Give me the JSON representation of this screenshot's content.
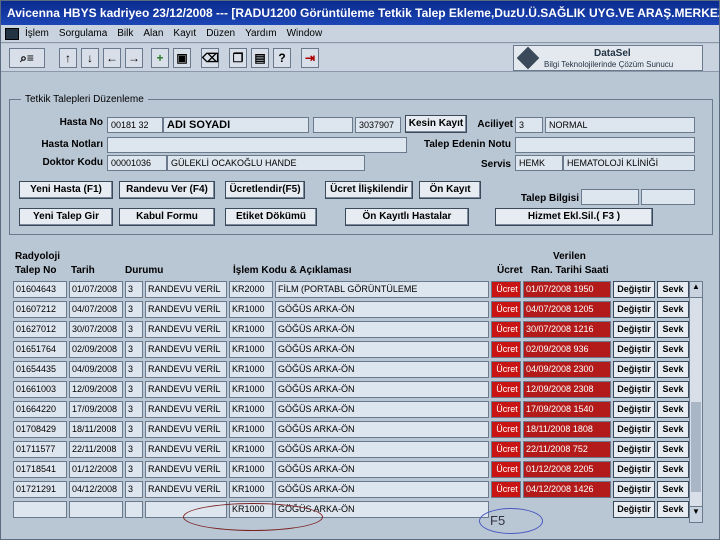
{
  "window": {
    "title": "Avicenna HBYS kadriyeo 23/12/2008 --- [RADU1200 Görüntüleme Tetkik Talep Ekleme,DuzU.Ü.SAĞLIK UYG.VE ARAŞ.MERKEZİ]"
  },
  "menu": [
    "İşlem",
    "Sorgulama",
    "Bilk",
    "Alan",
    "Kayıt",
    "Düzen",
    "Yardım",
    "Window"
  ],
  "toolbar": {
    "icons": [
      "query-icon",
      "arrow-up-icon",
      "arrow-down-icon",
      "arrow-left-icon",
      "arrow-right-icon",
      "insert-icon",
      "save-icon",
      "delete-icon",
      "copy-icon",
      "paste-icon",
      "help-icon",
      "exit-icon"
    ]
  },
  "logo": {
    "name": "DataSel",
    "tagline": "Bilgi Teknolojilerinde Çözüm Sunucu"
  },
  "form": {
    "section_title": "Tetkik Talepleri Düzenleme",
    "hasta_no_label": "Hasta No",
    "hasta_no": "00181 32",
    "hasta_adi": "ADI SOYADI",
    "protokol": "3037907",
    "kesin_kayit": "Kesin Kayıt",
    "aciliyet_label": "Aciliyet",
    "aciliyet_kod": "3",
    "aciliyet": "NORMAL",
    "hasta_notlari_label": "Hasta Notları",
    "talep_eden_notu_label": "Talep Edenin Notu",
    "doktor_kodu_label": "Doktor Kodu",
    "doktor_kodu": "00001036",
    "doktor_adi": "GÜLEKLİ OCAKOĞLU HANDE",
    "servis_label": "Servis",
    "servis_kod": "HEMK",
    "servis": "HEMATOLOJİ KLİNİĞİ",
    "talep_bilgisi_label": "Talep Bilgisi"
  },
  "buttons": {
    "yeni_hasta": "Yeni Hasta (F1)",
    "randevu_ver": "Randevu Ver (F4)",
    "ucretlendir": "Ücretlendir(F5)",
    "ucret_iliskilendir": "Ücret İlişkilendir",
    "on_kayit": "Ön Kayıt",
    "yeni_talep_gir": "Yeni Talep Gir",
    "kabul_formu": "Kabul Formu",
    "etiket_dokumu": "Etiket Dökümü",
    "on_kayitli_hastalar": "Ön Kayıtlı Hastalar",
    "hizmet_ekl_sil": "Hizmet Ekl.Sil.( F3 )"
  },
  "table": {
    "headers": {
      "radyoloji": "Radyoloji",
      "talep_no": "Talep No",
      "tarih": "Tarih",
      "durumu": "Durumu",
      "islem": "İşlem Kodu & Açıklaması",
      "ucret": "Ücret",
      "verilen": "Verilen",
      "ran_tarihi": "Ran. Tarihi Saati"
    },
    "degistir": "Değiştir",
    "sevk": "Sevk",
    "rows": [
      {
        "talep_no": "01604643",
        "tarih": "01/07/2008",
        "d1": "3",
        "durum": "RANDEVU VERİL",
        "kod": "KR2000",
        "aciklama": "FİLM (PORTABL GÖRÜNTÜLEME",
        "ucret": "Ücret",
        "ran": "01/07/2008 1950"
      },
      {
        "talep_no": "01607212",
        "tarih": "04/07/2008",
        "d1": "3",
        "durum": "RANDEVU VERİL",
        "kod": "KR1000",
        "aciklama": "GÖĞÜS ARKA-ÖN",
        "ucret": "Ücret",
        "ran": "04/07/2008 1205"
      },
      {
        "talep_no": "01627012",
        "tarih": "30/07/2008",
        "d1": "3",
        "durum": "RANDEVU VERİL",
        "kod": "KR1000",
        "aciklama": "GÖĞÜS ARKA-ÖN",
        "ucret": "Ücret",
        "ran": "30/07/2008 1216"
      },
      {
        "talep_no": "01651764",
        "tarih": "02/09/2008",
        "d1": "3",
        "durum": "RANDEVU VERİL",
        "kod": "KR1000",
        "aciklama": "GÖĞÜS ARKA-ÖN",
        "ucret": "Ücret",
        "ran": "02/09/2008 936"
      },
      {
        "talep_no": "01654435",
        "tarih": "04/09/2008",
        "d1": "3",
        "durum": "RANDEVU VERİL",
        "kod": "KR1000",
        "aciklama": "GÖĞÜS ARKA-ÖN",
        "ucret": "Ücret",
        "ran": "04/09/2008 2300"
      },
      {
        "talep_no": "01661003",
        "tarih": "12/09/2008",
        "d1": "3",
        "durum": "RANDEVU VERİL",
        "kod": "KR1000",
        "aciklama": "GÖĞÜS ARKA-ÖN",
        "ucret": "Ücret",
        "ran": "12/09/2008 2308"
      },
      {
        "talep_no": "01664220",
        "tarih": "17/09/2008",
        "d1": "3",
        "durum": "RANDEVU VERİL",
        "kod": "KR1000",
        "aciklama": "GÖĞÜS ARKA-ÖN",
        "ucret": "Ücret",
        "ran": "17/09/2008 1540"
      },
      {
        "talep_no": "01708429",
        "tarih": "18/11/2008",
        "d1": "3",
        "durum": "RANDEVU VERİL",
        "kod": "KR1000",
        "aciklama": "GÖĞÜS ARKA-ÖN",
        "ucret": "Ücret",
        "ran": "18/11/2008 1808"
      },
      {
        "talep_no": "01711577",
        "tarih": "22/11/2008",
        "d1": "3",
        "durum": "RANDEVU VERİL",
        "kod": "KR1000",
        "aciklama": "GÖĞÜS ARKA-ÖN",
        "ucret": "Ücret",
        "ran": "22/11/2008 752"
      },
      {
        "talep_no": "01718541",
        "tarih": "01/12/2008",
        "d1": "3",
        "durum": "RANDEVU VERİL",
        "kod": "KR1000",
        "aciklama": "GÖĞÜS ARKA-ÖN",
        "ucret": "Ücret",
        "ran": "01/12/2008 2205"
      },
      {
        "talep_no": "01721291",
        "tarih": "04/12/2008",
        "d1": "3",
        "durum": "RANDEVU VERİL",
        "kod": "KR1000",
        "aciklama": "GÖĞÜS ARKA-ÖN",
        "ucret": "Ücret",
        "ran": "04/12/2008 1426"
      }
    ],
    "new_row": {
      "kod": "KR1000",
      "aciklama": "GÖĞÜS ARKA-ÖN"
    }
  },
  "annotation": {
    "f5": "F5"
  },
  "colors": {
    "titlebar": "#0a2a8e",
    "ucret": "#c91414",
    "background": "#b9c6d4"
  }
}
